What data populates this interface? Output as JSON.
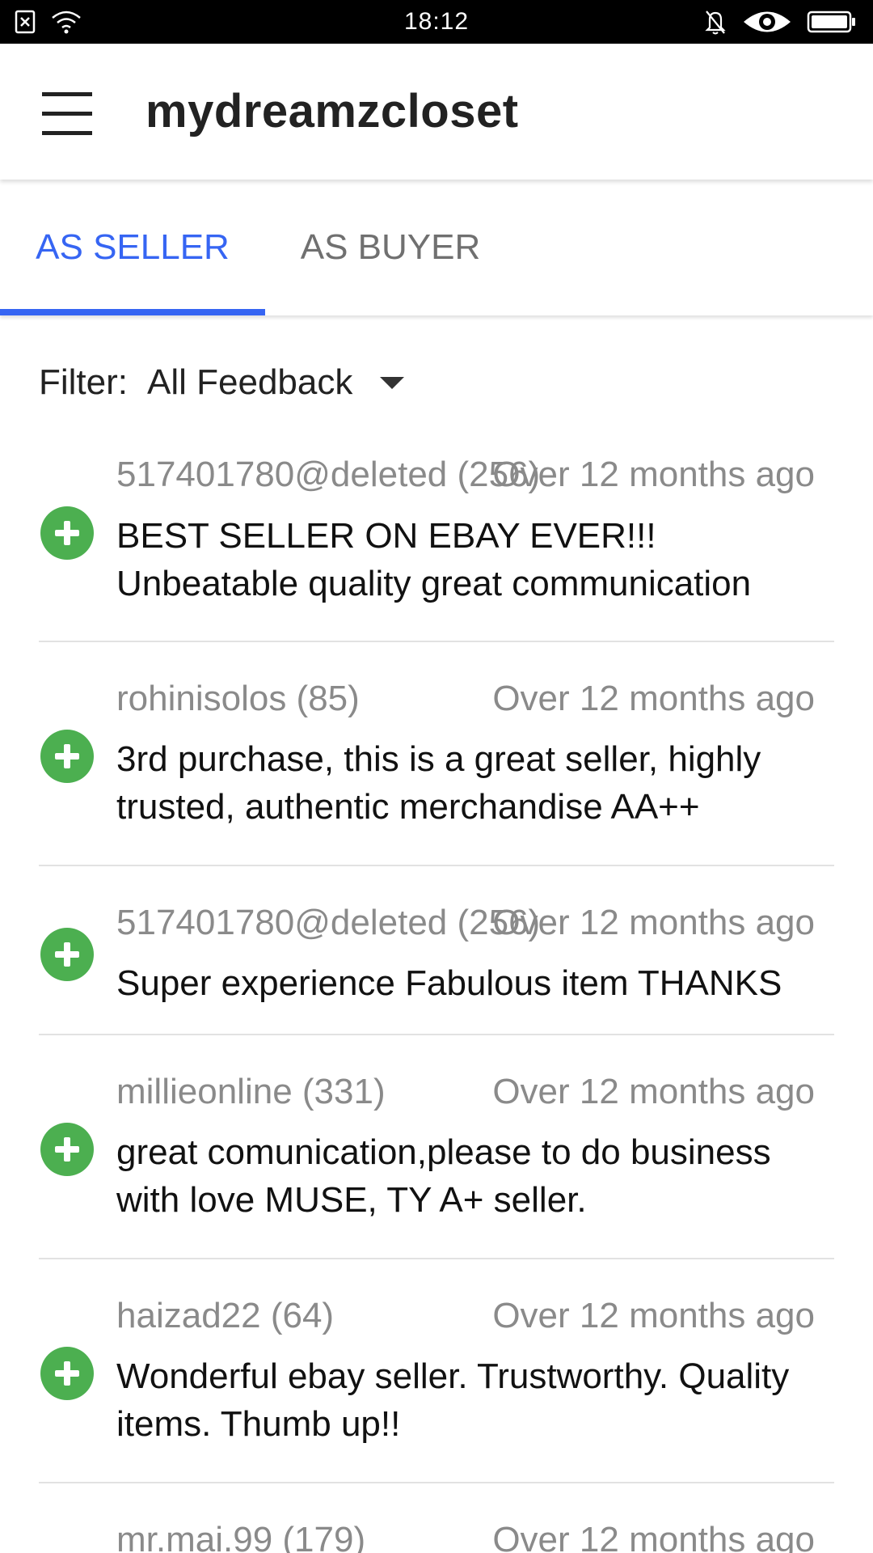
{
  "status_bar": {
    "time": "18:12",
    "left_icons": [
      "sim-card-x-icon",
      "wifi-icon"
    ],
    "right_icons": [
      "notifications-off-icon",
      "eye-icon",
      "battery-icon"
    ]
  },
  "app_bar": {
    "menu_icon": "hamburger-menu-icon",
    "title": "mydreamzcloset"
  },
  "tabs": [
    {
      "label": "AS SELLER",
      "selected": true
    },
    {
      "label": "AS BUYER",
      "selected": false
    }
  ],
  "filter": {
    "label": "Filter:",
    "value": "All Feedback"
  },
  "colors": {
    "accent": "#3665f3",
    "positive": "#4caf50",
    "muted_text": "#8a8a8a"
  },
  "feedback": [
    {
      "user": "517401780@deleted (256)",
      "time": "Over 12 months ago",
      "comment": "BEST SELLER ON EBAY EVER!!! Unbeatable quality great communication",
      "rating_icon": "positive-plus-icon"
    },
    {
      "user": "rohinisolos (85)",
      "time": "Over 12 months ago",
      "comment": "3rd purchase, this is a great seller, highly trusted, authentic merchandise AA++",
      "rating_icon": "positive-plus-icon"
    },
    {
      "user": "517401780@deleted (256)",
      "time": "Over 12 months ago",
      "comment": "Super experience Fabulous item THANKS",
      "rating_icon": "positive-plus-icon"
    },
    {
      "user": "millieonline (331)",
      "time": "Over 12 months ago",
      "comment": "great comunication,please to do business with love MUSE, TY A+ seller.",
      "rating_icon": "positive-plus-icon"
    },
    {
      "user": "haizad22 (64)",
      "time": "Over 12 months ago",
      "comment": "Wonderful ebay seller. Trustworthy. Quality items. Thumb up!!",
      "rating_icon": "positive-plus-icon"
    },
    {
      "user": "mr.mai.99 (179)",
      "time": "Over 12 months ago",
      "comment": "",
      "rating_icon": "positive-plus-icon"
    }
  ]
}
